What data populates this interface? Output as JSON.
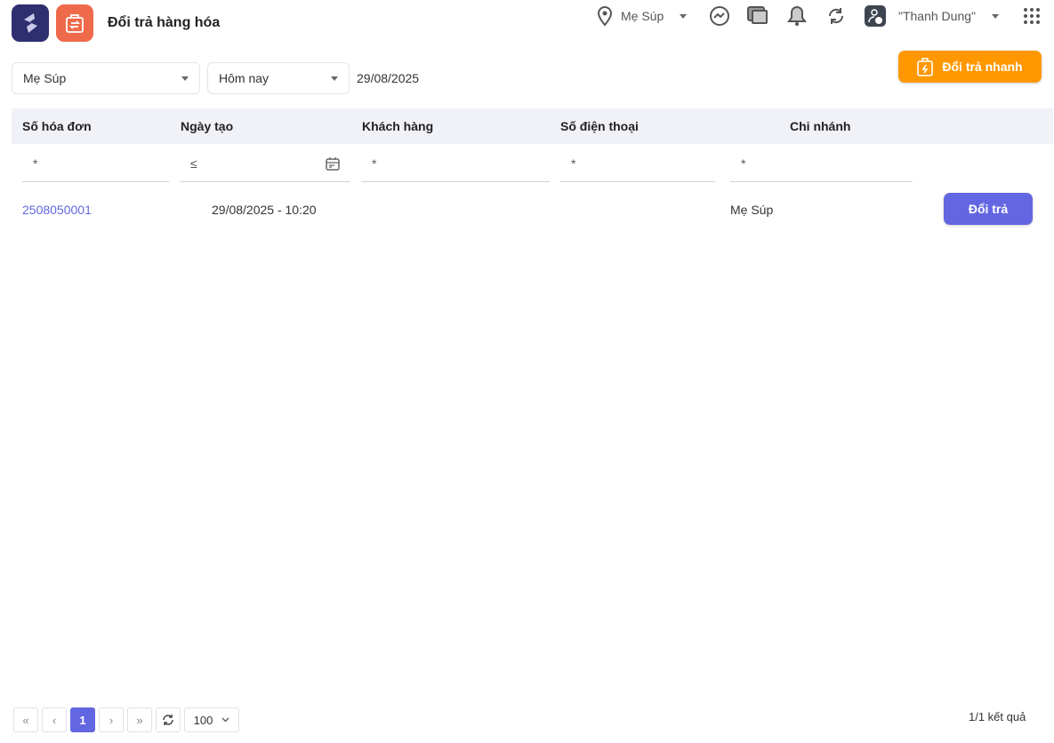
{
  "header": {
    "title": "Đổi trả hàng hóa",
    "branch": "Mẹ Súp",
    "user": "\"Thanh Dung\""
  },
  "filters": {
    "branch": "Mẹ Súp",
    "period": "Hôm nay",
    "date": "29/08/2025"
  },
  "quick_return_label": "Đổi trả nhanh",
  "table": {
    "columns": [
      "Số hóa đơn",
      "Ngày tạo",
      "Khách hàng",
      "Số điện thoại",
      "Chi nhánh"
    ],
    "filters": [
      "*",
      "≤",
      "*",
      "*",
      "*"
    ],
    "rows": [
      {
        "invoice": "2508050001",
        "created": "29/08/2025 - 10:20",
        "customer": "",
        "phone": "",
        "branch": "Mẹ Súp",
        "action": "Đổi trả"
      }
    ]
  },
  "pagination": {
    "first": "«",
    "prev": "‹",
    "current": "1",
    "next": "›",
    "last": "»",
    "page_size": "100",
    "summary": "1/1 kết quả"
  },
  "colors": {
    "primary": "#6366e1",
    "orange": "#ff9800",
    "logo": "#2e2f6e",
    "app": "#ee6a4b"
  }
}
